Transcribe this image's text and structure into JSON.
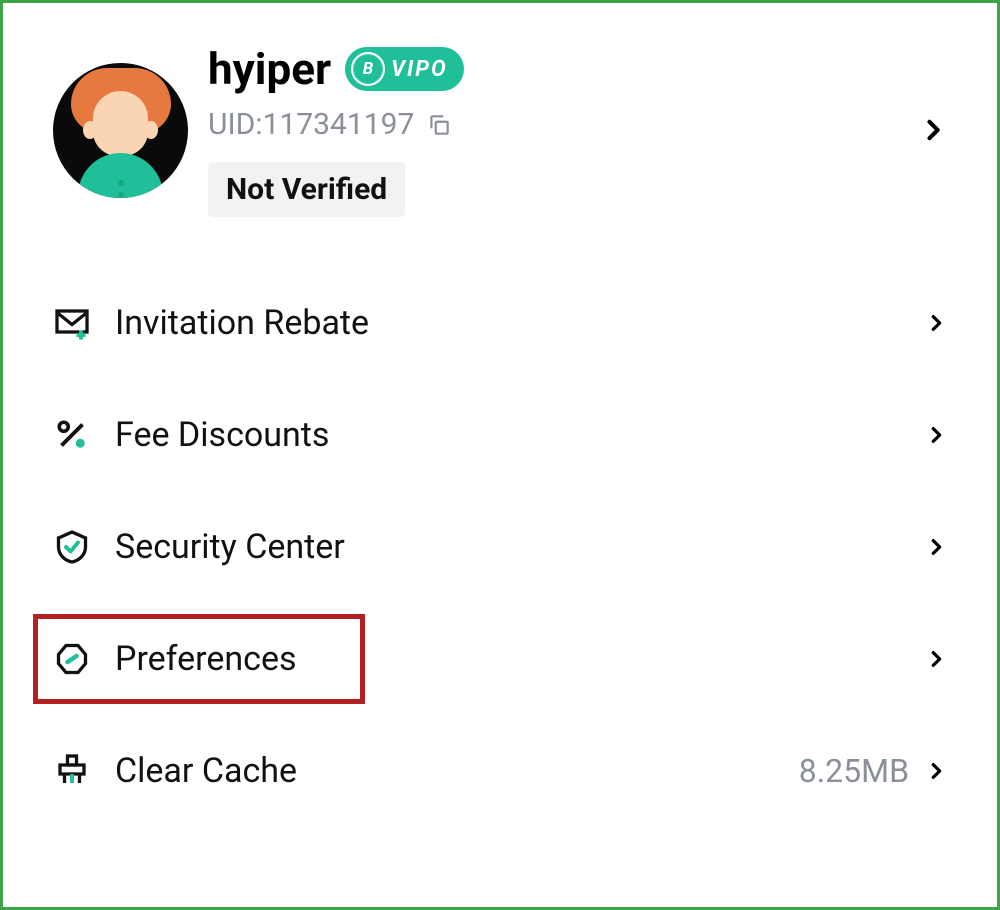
{
  "profile": {
    "username": "hyiper",
    "vip_badge_letter": "B",
    "vip_badge_text": "VIPO",
    "uid_label": "UID:117341197",
    "verify_status": "Not Verified"
  },
  "menu": {
    "items": [
      {
        "label": "Invitation Rebate",
        "value": ""
      },
      {
        "label": "Fee Discounts",
        "value": ""
      },
      {
        "label": "Security Center",
        "value": ""
      },
      {
        "label": "Preferences",
        "value": ""
      },
      {
        "label": "Clear Cache",
        "value": "8.25MB"
      }
    ]
  }
}
